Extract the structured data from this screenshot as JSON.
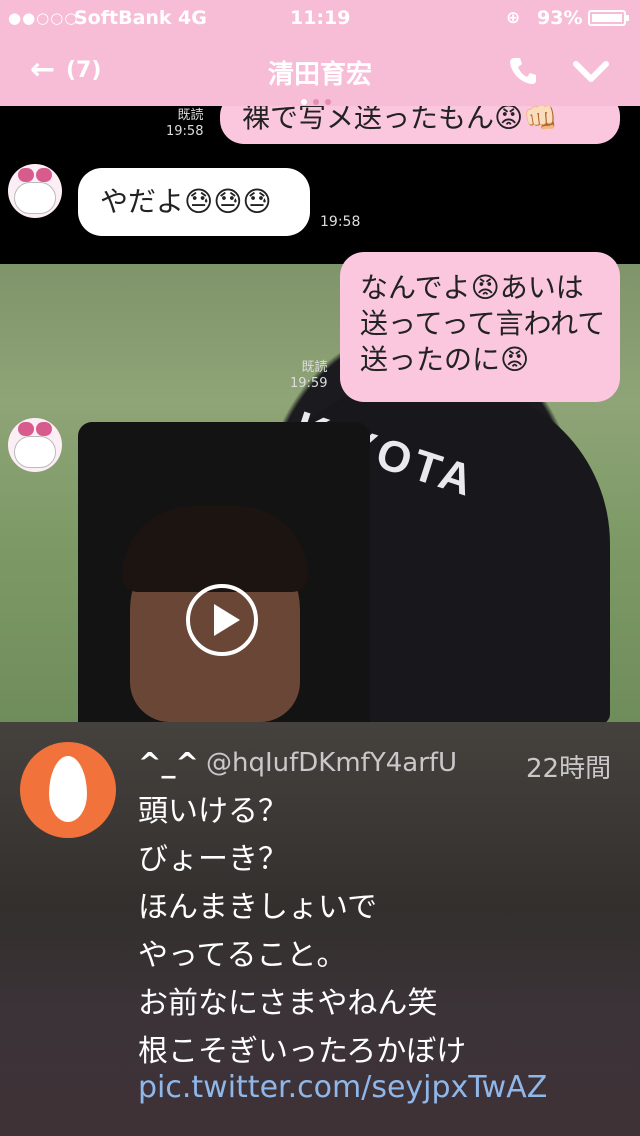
{
  "status_bar": {
    "signal": "●●○○○",
    "carrier": "SoftBank",
    "network": "4G",
    "time": "11:19",
    "lock": "⊕",
    "battery_pct": "93%"
  },
  "header": {
    "back_arrow": "←",
    "back_count": "(7)",
    "title": "清田育宏",
    "phone_icon": "phone-icon",
    "chevron_icon": "chevron-down-icon"
  },
  "chat": {
    "messages": [
      {
        "text": "裸で写メ送ったもん😡👊🏻",
        "read": "既読",
        "time": "19:58",
        "side": "right"
      },
      {
        "text": "やだよ😓😓😓",
        "time": "19:58",
        "side": "left"
      },
      {
        "lines": [
          "なんでよ😡あいは",
          "送ってって言われて",
          "送ったのに😡"
        ],
        "read": "既読",
        "time": "19:59",
        "side": "right"
      }
    ],
    "jersey_text": "KIYOTA",
    "video_icon": "play-icon"
  },
  "tweet": {
    "name": "^_^",
    "handle": "@hqIufDKmfY4arfU",
    "time": "22時間",
    "lines": [
      "頭いける？",
      "びょーき？",
      "ほんまきしょいで",
      "やってること。",
      "お前なにさまやねん笑",
      "根こそぎいったろかぼけ"
    ],
    "link": "pic.twitter.com/seyjpxTwAZ"
  },
  "colors": {
    "header_pink": "#f7bcd6",
    "bubble_pink": "#fbc7df",
    "avatar_orange": "#f1733b",
    "link_blue": "#8fb7ea"
  }
}
